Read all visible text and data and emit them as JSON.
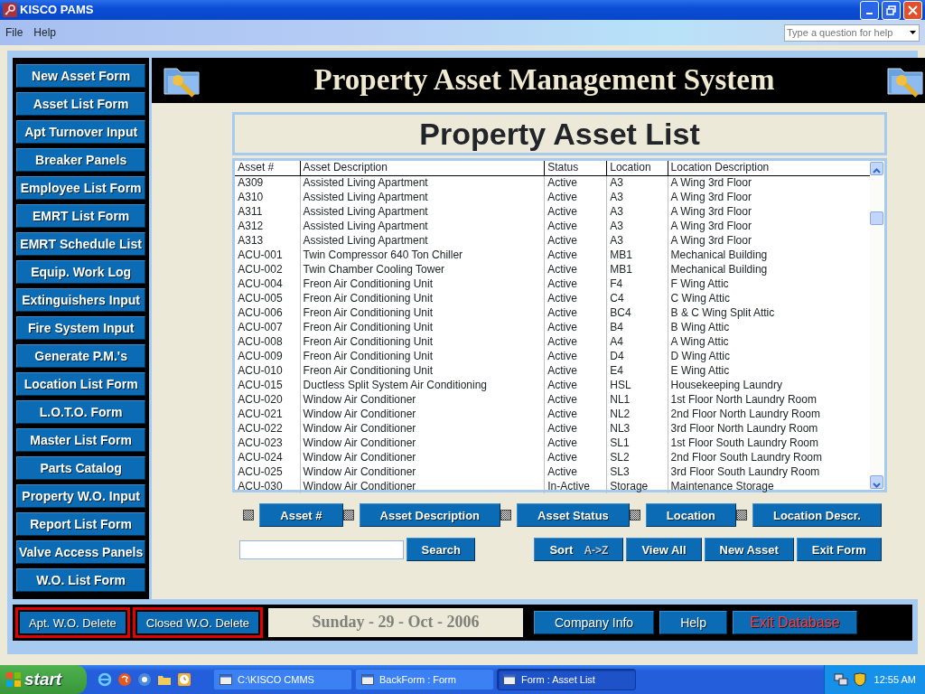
{
  "window": {
    "title": "KISCO PAMS"
  },
  "menu": [
    "File",
    "Help"
  ],
  "help_box": {
    "placeholder": "Type a question for help"
  },
  "sidebar": {
    "buttons": [
      "New Asset Form",
      "Asset List Form",
      "Apt Turnover Input",
      "Breaker Panels",
      "Employee List Form",
      "EMRT List Form",
      "EMRT Schedule List",
      "Equip. Work Log",
      "Extinguishers Input",
      "Fire System Input",
      "Generate P.M.'s",
      "Location List Form",
      "L.O.T.O. Form",
      "Master List Form",
      "Parts Catalog",
      "Property W.O. Input",
      "Report List Form",
      "Valve Access Panels",
      "W.O. List Form"
    ]
  },
  "header": {
    "title": "Property Asset Management System"
  },
  "form_title": "Property Asset List",
  "list": {
    "columns": [
      "Asset #",
      "Asset Description",
      "Status",
      "Location",
      "Location Description"
    ],
    "rows": [
      [
        "A309",
        "Assisted Living Apartment",
        "Active",
        "A3",
        "A Wing 3rd Floor"
      ],
      [
        "A310",
        "Assisted Living Apartment",
        "Active",
        "A3",
        "A Wing 3rd Floor"
      ],
      [
        "A311",
        "Assisted Living Apartment",
        "Active",
        "A3",
        "A Wing 3rd Floor"
      ],
      [
        "A312",
        "Assisted Living Apartment",
        "Active",
        "A3",
        "A Wing 3rd Floor"
      ],
      [
        "A313",
        "Assisted Living Apartment",
        "Active",
        "A3",
        "A Wing 3rd Floor"
      ],
      [
        "ACU-001",
        "Twin Compressor 640 Ton Chiller",
        "Active",
        "MB1",
        "Mechanical Building"
      ],
      [
        "ACU-002",
        "Twin Chamber Cooling Tower",
        "Active",
        "MB1",
        "Mechanical Building"
      ],
      [
        "ACU-004",
        "Freon Air Conditioning Unit",
        "Active",
        "F4",
        "F Wing Attic"
      ],
      [
        "ACU-005",
        "Freon Air Conditioning Unit",
        "Active",
        "C4",
        "C Wing Attic"
      ],
      [
        "ACU-006",
        "Freon Air Conditioning Unit",
        "Active",
        "BC4",
        "B & C Wing Split Attic"
      ],
      [
        "ACU-007",
        "Freon Air Conditioning Unit",
        "Active",
        "B4",
        "B Wing Attic"
      ],
      [
        "ACU-008",
        "Freon Air Conditioning Unit",
        "Active",
        "A4",
        "A Wing Attic"
      ],
      [
        "ACU-009",
        "Freon Air Conditioning Unit",
        "Active",
        "D4",
        "D Wing Attic"
      ],
      [
        "ACU-010",
        "Freon Air Conditioning Unit",
        "Active",
        "E4",
        "E Wing Attic"
      ],
      [
        "ACU-015",
        "Ductless Split System Air Conditioning",
        "Active",
        "HSL",
        "Housekeeping Laundry"
      ],
      [
        "ACU-020",
        "Window Air Conditioner",
        "Active",
        "NL1",
        "1st Floor North Laundry Room"
      ],
      [
        "ACU-021",
        "Window Air Conditioner",
        "Active",
        "NL2",
        "2nd Floor North Laundry Room"
      ],
      [
        "ACU-022",
        "Window Air Conditioner",
        "Active",
        "NL3",
        "3rd Floor North Laundry Room"
      ],
      [
        "ACU-023",
        "Window Air Conditioner",
        "Active",
        "SL1",
        "1st Floor South Laundry Room"
      ],
      [
        "ACU-024",
        "Window Air Conditioner",
        "Active",
        "SL2",
        "2nd Floor South Laundry Room"
      ],
      [
        "ACU-025",
        "Window Air Conditioner",
        "Active",
        "SL3",
        "3rd Floor South Laundry Room"
      ],
      [
        "ACU-030",
        "Window Air Conditioner",
        "In-Active",
        "Storage",
        "Maintenance Storage"
      ]
    ]
  },
  "filters": [
    {
      "label": "Asset #",
      "indeterminate": true
    },
    {
      "label": "Asset Description",
      "indeterminate": true
    },
    {
      "label": "Asset Status",
      "indeterminate": true
    },
    {
      "label": "Location",
      "indeterminate": true
    },
    {
      "label": "Location Descr.",
      "indeterminate": true
    }
  ],
  "search_button": "Search",
  "actions": [
    {
      "label": "Sort",
      "hint": "A->Z"
    },
    {
      "label": "View All"
    },
    {
      "label": "New Asset"
    },
    {
      "label": "Exit Form"
    }
  ],
  "bottom": {
    "delete_buttons": [
      "Apt. W.O. Delete",
      "Closed W.O. Delete"
    ],
    "date": "Sunday - 29 - Oct - 2006",
    "buttons": [
      {
        "label": "Company Info",
        "kind": "normal"
      },
      {
        "label": "Help",
        "kind": "normal"
      },
      {
        "label": "Exit Database",
        "kind": "danger"
      }
    ]
  },
  "taskbar": {
    "start": "start",
    "tasks": [
      {
        "label": "C:\\KISCO CMMS",
        "selected": false
      },
      {
        "label": "BackForm : Form",
        "selected": false
      },
      {
        "label": "Form : Asset List",
        "selected": true
      }
    ],
    "clock": "12:55 AM"
  }
}
